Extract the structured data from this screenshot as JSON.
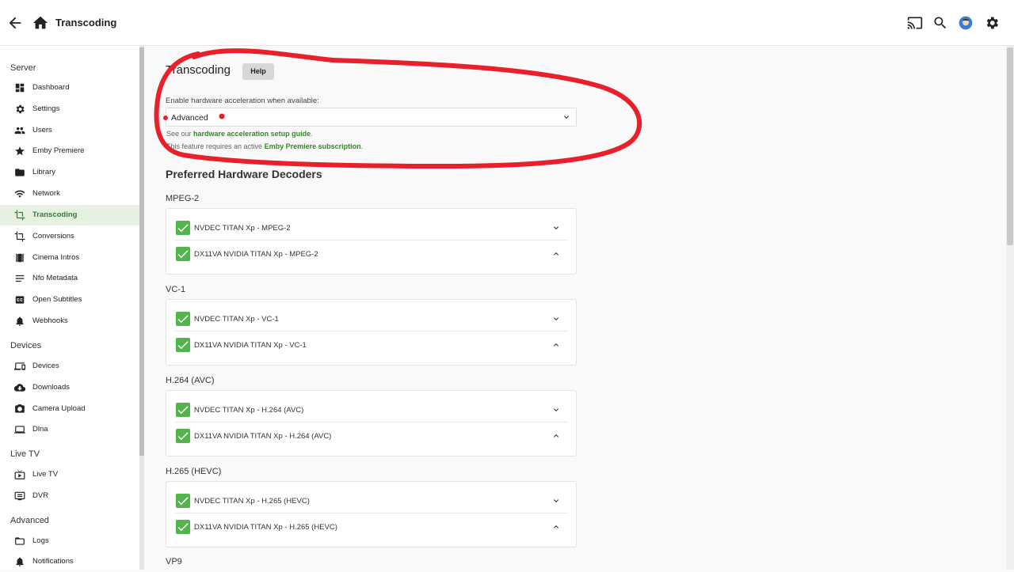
{
  "header": {
    "title": "Transcoding"
  },
  "sidebar": {
    "sections": [
      {
        "label": "Server",
        "items": [
          "Dashboard",
          "Settings",
          "Users",
          "Emby Premiere",
          "Library",
          "Network",
          "Transcoding",
          "Conversions",
          "Cinema Intros",
          "Nfo Metadata",
          "Open Subtitles",
          "Webhooks"
        ]
      },
      {
        "label": "Devices",
        "items": [
          "Devices",
          "Downloads",
          "Camera Upload",
          "Dlna"
        ]
      },
      {
        "label": "Live TV",
        "items": [
          "Live TV",
          "DVR"
        ]
      },
      {
        "label": "Advanced",
        "items": [
          "Logs",
          "Notifications"
        ]
      }
    ],
    "active_item": "Transcoding"
  },
  "main": {
    "title": "Transcoding",
    "help_label": "Help",
    "hw_accel": {
      "label": "Enable hardware acceleration when available:",
      "value": "Advanced",
      "note1_prefix": "See our ",
      "note1_link": "hardware acceleration setup guide",
      "note1_suffix": ".",
      "note2_prefix": "This feature requires an active ",
      "note2_link": "Emby Premiere subscription",
      "note2_suffix": "."
    },
    "decoders_title": "Preferred Hardware Decoders",
    "groups": [
      {
        "name": "MPEG-2",
        "items": [
          "NVDEC TITAN Xp - MPEG-2",
          "DX11VA NVIDIA TITAN Xp - MPEG-2"
        ]
      },
      {
        "name": "VC-1",
        "items": [
          "NVDEC TITAN Xp - VC-1",
          "DX11VA NVIDIA TITAN Xp - VC-1"
        ]
      },
      {
        "name": "H.264 (AVC)",
        "items": [
          "NVDEC TITAN Xp - H.264 (AVC)",
          "DX11VA NVIDIA TITAN Xp - H.264 (AVC)"
        ]
      },
      {
        "name": "H.265 (HEVC)",
        "items": [
          "NVDEC TITAN Xp - H.265 (HEVC)",
          "DX11VA NVIDIA TITAN Xp - H.265 (HEVC)"
        ]
      },
      {
        "name": "VP9",
        "items": []
      }
    ]
  },
  "colors": {
    "accent": "#52b54b",
    "annotation": "#e8202a"
  }
}
